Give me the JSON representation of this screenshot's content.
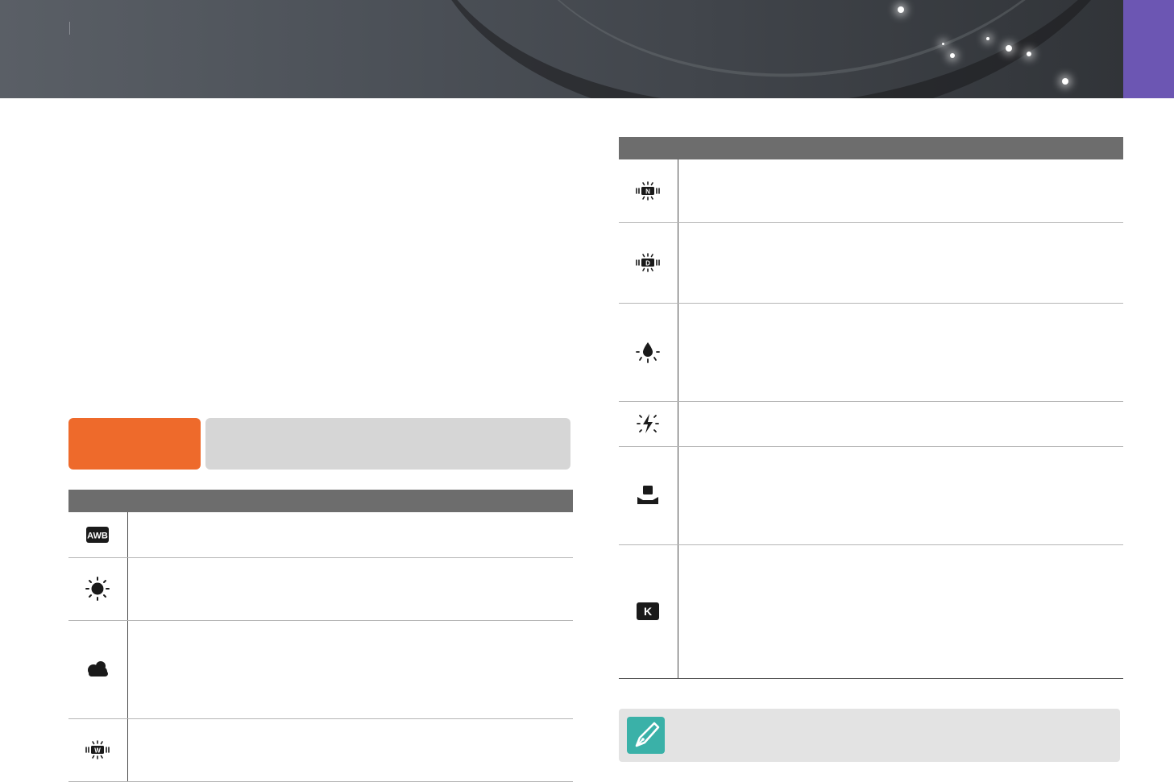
{
  "colors": {
    "header_bg": "#4a4e54",
    "section_tab": "#6c56b3",
    "option_label_bg": "#ee6a2b",
    "option_bar_bg": "#d6d6d6",
    "table_header_bg": "#6d6d6d",
    "note_bg": "#e3e3e3",
    "note_icon_bg": "#3ab1a8"
  },
  "icons": {
    "header_section_tab": "purple-tab",
    "note": "pen-nib-icon",
    "left_table": [
      "awb-icon",
      "daylight-sun-icon",
      "cloudy-icon",
      "fluorescent-w-icon"
    ],
    "right_table": [
      "fluorescent-n-icon",
      "fluorescent-d-icon",
      "tungsten-bulb-icon",
      "flash-wb-icon",
      "custom-set-icon",
      "kelvin-k-icon"
    ]
  },
  "left_table": {
    "rows": [
      {
        "icon": "awb-icon",
        "description": ""
      },
      {
        "icon": "daylight-sun-icon",
        "description": ""
      },
      {
        "icon": "cloudy-icon",
        "description": ""
      },
      {
        "icon": "fluorescent-w-icon",
        "description": ""
      }
    ]
  },
  "right_table": {
    "rows": [
      {
        "icon": "fluorescent-n-icon",
        "description": ""
      },
      {
        "icon": "fluorescent-d-icon",
        "description": ""
      },
      {
        "icon": "tungsten-bulb-icon",
        "description": ""
      },
      {
        "icon": "flash-wb-icon",
        "description": ""
      },
      {
        "icon": "custom-set-icon",
        "description": ""
      },
      {
        "icon": "kelvin-k-icon",
        "description": ""
      }
    ]
  },
  "icon_glyph_text": {
    "fluorescent_n": "N",
    "fluorescent_d": "D",
    "fluorescent_w": "W",
    "kelvin": "K",
    "awb": "AWB"
  }
}
